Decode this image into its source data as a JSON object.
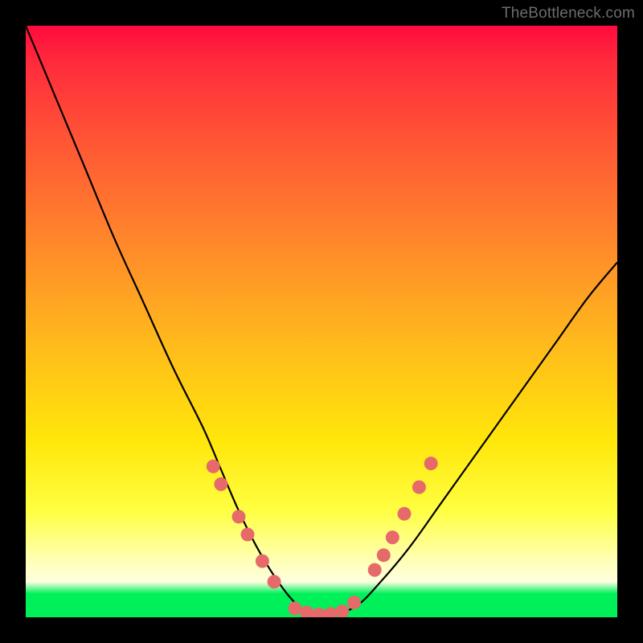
{
  "watermark": "TheBottleneck.com",
  "colors": {
    "background": "#000000",
    "curve": "#000000",
    "dot_fill": "#e66a6a",
    "dot_stroke": "#d24f4f",
    "gradient_stops": [
      "#ff0a3e",
      "#ff2a3c",
      "#ff5136",
      "#ff7a2e",
      "#ffb51e",
      "#ffe60a",
      "#ffff42",
      "#ffffb0",
      "#ffffe0",
      "#00f05a"
    ]
  },
  "chart_data": {
    "type": "line",
    "title": "",
    "xlabel": "",
    "ylabel": "",
    "xlim": [
      0,
      1
    ],
    "ylim": [
      0,
      1
    ],
    "series": [
      {
        "name": "bottleneck-curve",
        "x": [
          0.0,
          0.05,
          0.1,
          0.15,
          0.2,
          0.25,
          0.3,
          0.33,
          0.36,
          0.39,
          0.42,
          0.45,
          0.48,
          0.52,
          0.56,
          0.6,
          0.65,
          0.7,
          0.75,
          0.8,
          0.85,
          0.9,
          0.95,
          1.0
        ],
        "y": [
          1.0,
          0.88,
          0.76,
          0.64,
          0.53,
          0.42,
          0.32,
          0.25,
          0.18,
          0.12,
          0.07,
          0.03,
          0.005,
          0.005,
          0.02,
          0.06,
          0.12,
          0.19,
          0.26,
          0.33,
          0.4,
          0.47,
          0.54,
          0.6
        ]
      }
    ],
    "dots": [
      {
        "name": "left-upper-1",
        "x": 0.317,
        "y": 0.255
      },
      {
        "name": "left-upper-2",
        "x": 0.33,
        "y": 0.225
      },
      {
        "name": "left-mid-1",
        "x": 0.36,
        "y": 0.17
      },
      {
        "name": "left-mid-2",
        "x": 0.375,
        "y": 0.14
      },
      {
        "name": "left-low-1",
        "x": 0.4,
        "y": 0.095
      },
      {
        "name": "left-low-2",
        "x": 0.42,
        "y": 0.06
      },
      {
        "name": "bottom-1",
        "x": 0.455,
        "y": 0.015
      },
      {
        "name": "bottom-2",
        "x": 0.475,
        "y": 0.008
      },
      {
        "name": "bottom-3",
        "x": 0.495,
        "y": 0.005
      },
      {
        "name": "bottom-4",
        "x": 0.515,
        "y": 0.006
      },
      {
        "name": "bottom-5",
        "x": 0.535,
        "y": 0.01
      },
      {
        "name": "right-low-1",
        "x": 0.555,
        "y": 0.025
      },
      {
        "name": "right-mid-1",
        "x": 0.59,
        "y": 0.08
      },
      {
        "name": "right-mid-2",
        "x": 0.605,
        "y": 0.105
      },
      {
        "name": "right-mid-3",
        "x": 0.62,
        "y": 0.135
      },
      {
        "name": "right-upper-1",
        "x": 0.64,
        "y": 0.175
      },
      {
        "name": "right-upper-2",
        "x": 0.665,
        "y": 0.22
      },
      {
        "name": "right-upper-3",
        "x": 0.685,
        "y": 0.26
      }
    ]
  }
}
